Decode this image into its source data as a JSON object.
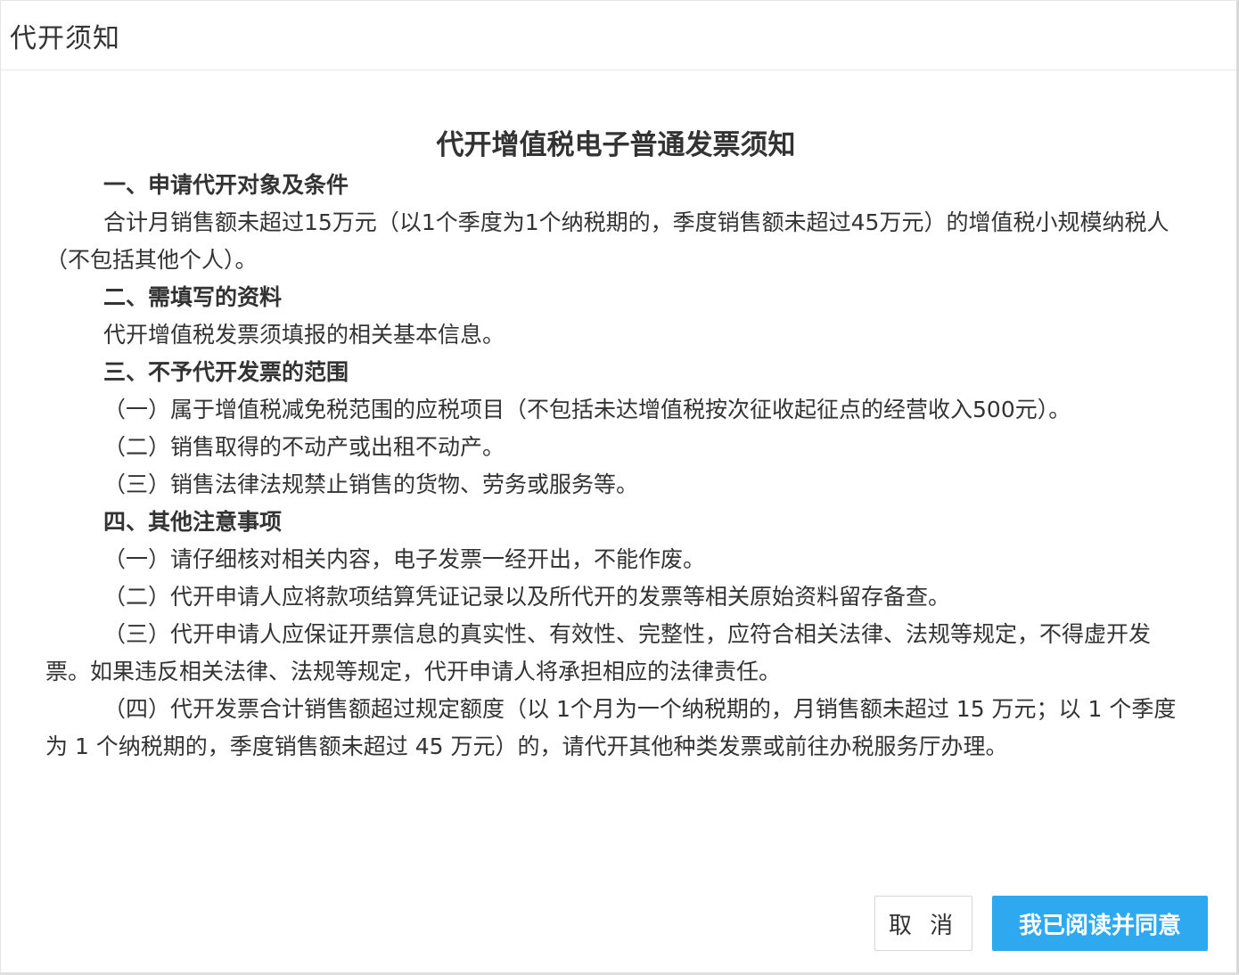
{
  "dialog": {
    "title": "代开须知"
  },
  "notice": {
    "heading": "代开增值税电子普通发票须知",
    "sections": [
      {
        "title": "一、申请代开对象及条件",
        "paragraphs": [
          "合计月销售额未超过15万元（以1个季度为1个纳税期的，季度销售额未超过45万元）的增值税小规模纳税人（不包括其他个人）。"
        ]
      },
      {
        "title": "二、需填写的资料",
        "paragraphs": [
          "代开增值税发票须填报的相关基本信息。"
        ]
      },
      {
        "title": "三、不予代开发票的范围",
        "paragraphs": [
          "（一）属于增值税减免税范围的应税项目（不包括未达增值税按次征收起征点的经营收入500元）。",
          "（二）销售取得的不动产或出租不动产。",
          "（三）销售法律法规禁止销售的货物、劳务或服务等。"
        ]
      },
      {
        "title": "四、其他注意事项",
        "paragraphs": [
          "（一）请仔细核对相关内容，电子发票一经开出，不能作废。",
          "（二）代开申请人应将款项结算凭证记录以及所代开的发票等相关原始资料留存备查。",
          "（三）代开申请人应保证开票信息的真实性、有效性、完整性，应符合相关法律、法规等规定，不得虚开发票。如果违反相关法律、法规等规定，代开申请人将承担相应的法律责任。",
          "（四）代开发票合计销售额超过规定额度（以 1个月为一个纳税期的，月销售额未超过 15 万元；以 1 个季度为 1 个纳税期的，季度销售额未超过 45 万元）的，请代开其他种类发票或前往办税服务厅办理。"
        ]
      }
    ]
  },
  "footer": {
    "cancel_label": "取 消",
    "agree_label": "我已阅读并同意"
  },
  "colors": {
    "primary_button": "#2ea9f0",
    "text": "#333333"
  }
}
